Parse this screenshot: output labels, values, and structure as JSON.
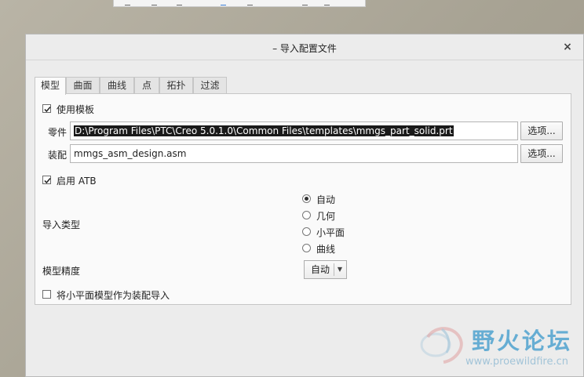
{
  "dialog": {
    "title": "– 导入配置文件",
    "close_glyph": "×"
  },
  "tabs": [
    {
      "label": "模型",
      "active": true
    },
    {
      "label": "曲面",
      "active": false
    },
    {
      "label": "曲线",
      "active": false
    },
    {
      "label": "点",
      "active": false
    },
    {
      "label": "拓扑",
      "active": false
    },
    {
      "label": "过滤",
      "active": false
    }
  ],
  "model_tab": {
    "use_template": {
      "label": "使用模板",
      "checked": true
    },
    "part": {
      "label": "零件",
      "value": "D:\\Program Files\\PTC\\Creo 5.0.1.0\\Common Files\\templates\\mmgs_part_solid.prt",
      "options_label": "选项..."
    },
    "assembly": {
      "label": "装配",
      "value": "mmgs_asm_design.asm",
      "options_label": "选项..."
    },
    "enable_atb": {
      "label": "启用 ATB",
      "checked": true
    },
    "import_type": {
      "label": "导入类型",
      "options": [
        {
          "label": "自动",
          "selected": true
        },
        {
          "label": "几何",
          "selected": false
        },
        {
          "label": "小平面",
          "selected": false
        },
        {
          "label": "曲线",
          "selected": false
        }
      ]
    },
    "model_precision": {
      "label": "模型精度",
      "value": "自动"
    },
    "facet_as_assembly": {
      "label": "将小平面模型作为装配导入",
      "checked": false
    }
  },
  "watermark": {
    "title": "野火论坛",
    "url": "www.proewildfire.cn"
  }
}
